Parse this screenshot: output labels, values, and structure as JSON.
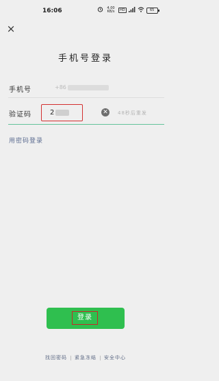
{
  "status_bar": {
    "time": "16:06",
    "speed": "4.00\nKB/s",
    "hd_label": "HD",
    "battery": "65",
    "icons": [
      "alarm-icon",
      "speed-indicator",
      "hd-icon",
      "signal-icon",
      "wifi-icon",
      "battery-icon"
    ]
  },
  "header": {
    "close_icon": "×",
    "title": "手机号登录"
  },
  "form": {
    "phone_label": "手机号",
    "phone_value": "+86",
    "code_label": "验证码",
    "code_value": "2",
    "clear_icon": "✕",
    "resend_text": "48秒后重发"
  },
  "links": {
    "password_login": "用密码登录"
  },
  "actions": {
    "login_label": "登录"
  },
  "footer": {
    "items": [
      "找回密码",
      "紧急冻结",
      "安全中心"
    ]
  },
  "colors": {
    "primary_green": "#2fbf4f",
    "highlight_red": "#d32f2f",
    "link_blue": "#5d6d91",
    "active_line": "#63c39a"
  }
}
